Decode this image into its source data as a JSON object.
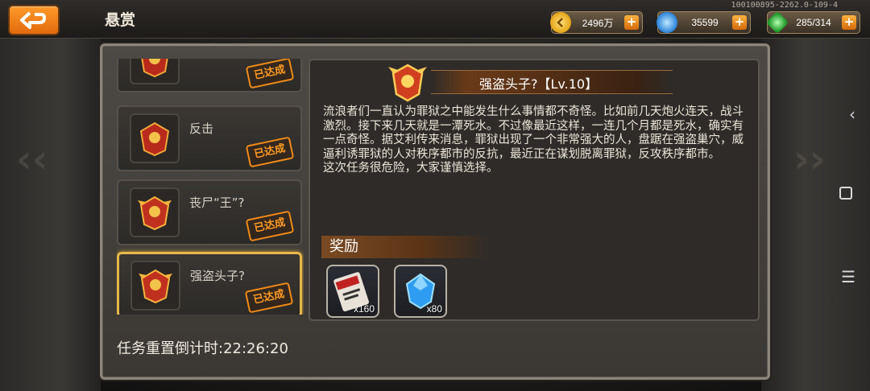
{
  "header": {
    "title": "悬赏",
    "build_info": "100100895-2262.0-109-4"
  },
  "resources": [
    {
      "name": "gold",
      "value": "2496万",
      "color": "#f2b41d"
    },
    {
      "name": "diamond",
      "value": "35599",
      "color": "#3aa6ff"
    },
    {
      "name": "energy",
      "value": "285/314",
      "color": "#39c24a"
    }
  ],
  "quests": [
    {
      "name": "",
      "status": "已达成",
      "selected": false
    },
    {
      "name": "反击",
      "status": "已达成",
      "selected": false
    },
    {
      "name": "丧尸“王”?",
      "status": "已达成",
      "selected": false
    },
    {
      "name": "强盗头子?",
      "status": "已达成",
      "selected": true
    }
  ],
  "detail": {
    "title": "强盗头子?【Lv.10】",
    "description": "流浪者们一直认为罪狱之中能发生什么事情都不奇怪。比如前几天炮火连天，战斗激烈。接下来几天就是一潭死水。不过像最近这样，一连几个月都是死水，确实有一点奇怪。据艾利传来消息，罪狱出现了一个非常强大的人，盘踞在强盗巢穴，威逼利诱罪狱的人对秩序都市的反抗，最近正在谋划脱离罪狱，反攻秩序都市。",
    "description2": "这次任务很危险，大家谨慎选择。",
    "reward_label": "奖励",
    "rewards": [
      {
        "name": "ticket",
        "qty": "x160"
      },
      {
        "name": "crystal",
        "qty": "x80"
      }
    ]
  },
  "footer": {
    "timer_label": "任务重置倒计时:22:26:20"
  }
}
